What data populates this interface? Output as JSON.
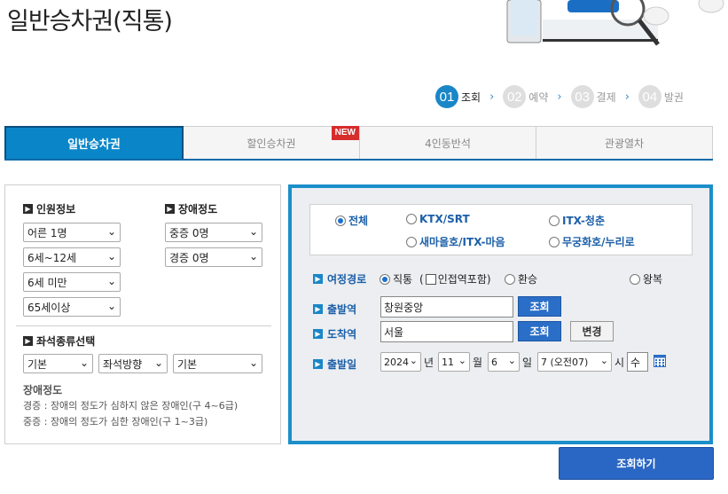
{
  "page": {
    "title": "일반승차권(직통)"
  },
  "steps": [
    {
      "num": "01",
      "label": "조회",
      "active": true
    },
    {
      "num": "02",
      "label": "예약",
      "active": false
    },
    {
      "num": "03",
      "label": "결제",
      "active": false
    },
    {
      "num": "04",
      "label": "발권",
      "active": false
    }
  ],
  "step_arrow": "›",
  "tabs": [
    {
      "label": "일반승차권",
      "active": true
    },
    {
      "label": "할인승차권",
      "badge": "NEW"
    },
    {
      "label": "4인동반석"
    },
    {
      "label": "관광열차"
    }
  ],
  "left": {
    "passenger_title": "인원정보",
    "disability_title": "장애정도",
    "passenger_selects": [
      "어른 1명",
      "6세~12세",
      "6세 미만",
      "65세이상"
    ],
    "disability_selects": [
      "중증 0명",
      "경증 0명"
    ],
    "seat_title": "좌석종류선택",
    "seat_selects": [
      "기본",
      "좌석방향",
      "기본"
    ],
    "note_title": "장애정도",
    "notes": [
      "경증 : 장애의 정도가 심하지 않은 장애인(구 4~6급)",
      "중증 : 장애의 정도가 심한 장애인(구 1~3급)"
    ]
  },
  "right": {
    "train_types": [
      "전체",
      "KTX/SRT",
      "ITX-청춘",
      "새마을호/ITX-마음",
      "무궁화호/누리로"
    ],
    "route_label": "여정경로",
    "route_options": [
      "직통",
      "인접역포함",
      "환승",
      "왕복"
    ],
    "route_paren_open": "(",
    "route_paren_close": ")",
    "depart_label": "출발역",
    "depart_value": "창원중앙",
    "arrive_label": "도착역",
    "arrive_value": "서울",
    "lookup_label": "조회",
    "change_label": "변경",
    "date_label": "출발일",
    "year": "2024",
    "year_unit": "년",
    "month": "11",
    "month_unit": "월",
    "day": "6",
    "day_unit": "일",
    "hour": "7 (오전07)",
    "hour_unit": "시",
    "weekday": "수"
  },
  "search_button": "조회하기",
  "colors": {
    "accent": "#1a86c8",
    "tab_active": "#0a86c8",
    "badge": "#d62d2d",
    "button": "#2a66c4"
  }
}
